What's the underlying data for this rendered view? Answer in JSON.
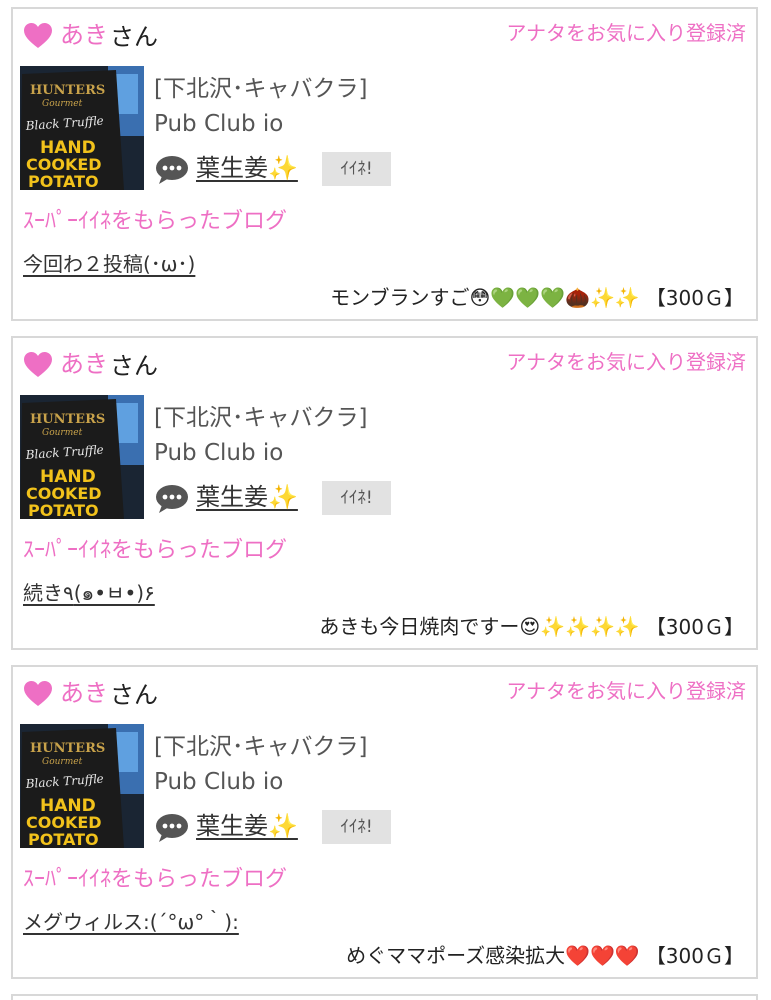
{
  "colors": {
    "accent_pink": "#ee6fc4",
    "card_border": "#d8d8d8",
    "button_bg": "#e2e2e2"
  },
  "icons": {
    "heart": "heart-icon",
    "chat": "speech-bubble-icon"
  },
  "posts": [
    {
      "user_name": "あき",
      "user_suffix": "さん",
      "favorite_status": "アナタをお気に入り登録済",
      "thumbnail_text": [
        "HUNTERS",
        "Gourmet",
        "Black Truffle",
        "HAND",
        "COOKED",
        "POTATO"
      ],
      "store_area": "[下北沢･キャバクラ]",
      "store_name": "Pub Club io",
      "staff_name": "葉生姜✨",
      "like_button": "ｲｲﾈ!",
      "super_like_label": "ｽｰﾊﾟｰｲｲﾈをもらったブログ",
      "blog_title": "今回わ２投稿(･ω･)",
      "comment": "モンブランすご😳💚💚💚🌰✨✨",
      "points": "【300Ｇ】"
    },
    {
      "user_name": "あき",
      "user_suffix": "さん",
      "favorite_status": "アナタをお気に入り登録済",
      "thumbnail_text": [
        "HUNTERS",
        "Gourmet",
        "Black Truffle",
        "HAND",
        "COOKED",
        "POTATO"
      ],
      "store_area": "[下北沢･キャバクラ]",
      "store_name": "Pub Club io",
      "staff_name": "葉生姜✨",
      "like_button": "ｲｲﾈ!",
      "super_like_label": "ｽｰﾊﾟｰｲｲﾈをもらったブログ",
      "blog_title": "続き٩(๑•ㅂ•)۶",
      "comment": "あきも今日焼肉ですー😍✨✨✨✨",
      "points": "【300Ｇ】"
    },
    {
      "user_name": "あき",
      "user_suffix": "さん",
      "favorite_status": "アナタをお気に入り登録済",
      "thumbnail_text": [
        "HUNTERS",
        "Gourmet",
        "Black Truffle",
        "HAND",
        "COOKED",
        "POTATO"
      ],
      "store_area": "[下北沢･キャバクラ]",
      "store_name": "Pub Club io",
      "staff_name": "葉生姜✨",
      "like_button": "ｲｲﾈ!",
      "super_like_label": "ｽｰﾊﾟｰｲｲﾈをもらったブログ",
      "blog_title": "メグウィルス:(´°ω°｀):",
      "comment": "めぐママポーズ感染拡大❤️❤️❤️",
      "points": "【300Ｇ】"
    }
  ]
}
